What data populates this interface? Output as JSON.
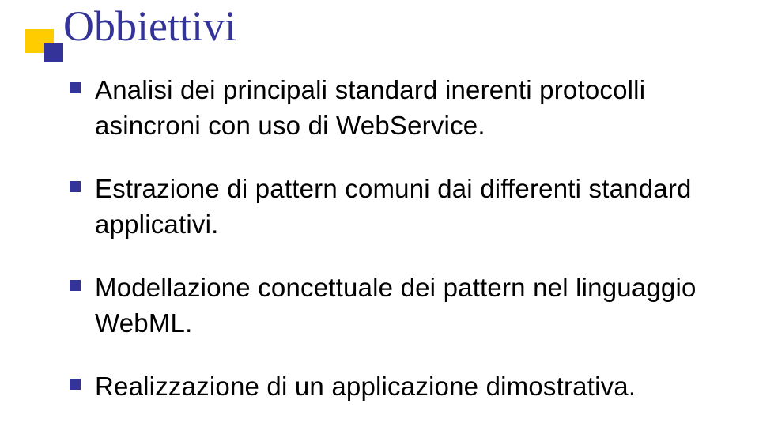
{
  "slide": {
    "title": "Obbiettivi",
    "bullets": [
      "Analisi dei principali standard inerenti protocolli asincroni con uso di WebService.",
      "Estrazione di pattern comuni dai differenti standard applicativi.",
      "Modellazione concettuale dei pattern nel linguaggio WebML.",
      "Realizzazione di un applicazione dimostrativa."
    ]
  }
}
